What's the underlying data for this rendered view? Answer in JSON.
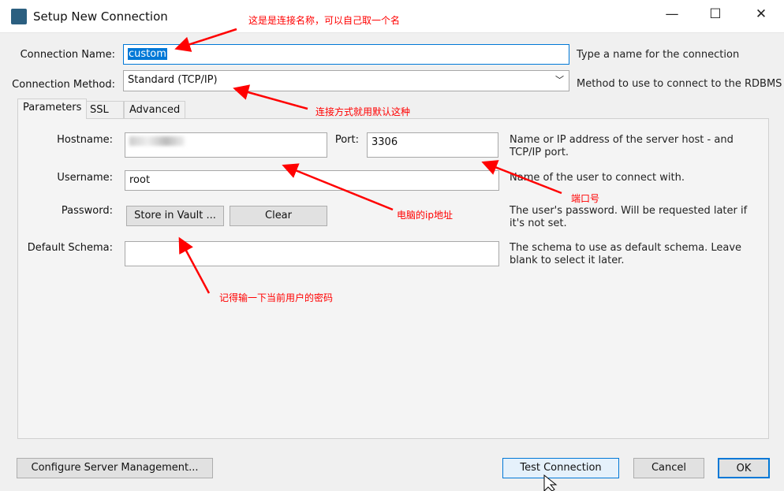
{
  "window": {
    "title": "Setup New Connection",
    "minimize": "—",
    "maximize": "☐",
    "close": "✕"
  },
  "form": {
    "connection_name_label": "Connection Name:",
    "connection_name_value": "custom",
    "connection_name_hint": "Type a name for the connection",
    "connection_method_label": "Connection Method:",
    "connection_method_value": "Standard (TCP/IP)",
    "connection_method_hint": "Method to use to connect to the RDBMS"
  },
  "tabs": [
    {
      "label": "Parameters",
      "active": true
    },
    {
      "label": "SSL"
    },
    {
      "label": "Advanced"
    }
  ],
  "parameters": {
    "hostname_label": "Hostname:",
    "hostname_value": "",
    "port_label": "Port:",
    "port_value": "3306",
    "hostname_hint": "Name or IP address of the server host - and TCP/IP port.",
    "username_label": "Username:",
    "username_value": "root",
    "username_hint": "Name of the user to connect with.",
    "password_label": "Password:",
    "store_vault": "Store in Vault ...",
    "clear": "Clear",
    "password_hint": "The user's password. Will be requested later if it's not set.",
    "schema_label": "Default Schema:",
    "schema_value": "",
    "schema_hint": "The schema to use as default schema. Leave blank to select it later."
  },
  "buttons": {
    "configure": "Configure Server Management...",
    "test": "Test Connection",
    "cancel": "Cancel",
    "ok": "OK"
  },
  "annotations": {
    "name": "这是是连接名称，可以自己取一个名",
    "method": "连接方式就用默认这种",
    "ip": "电脑的ip地址",
    "port": "端口号",
    "password": "记得输一下当前用户的密码",
    "color": "#ff0000"
  }
}
